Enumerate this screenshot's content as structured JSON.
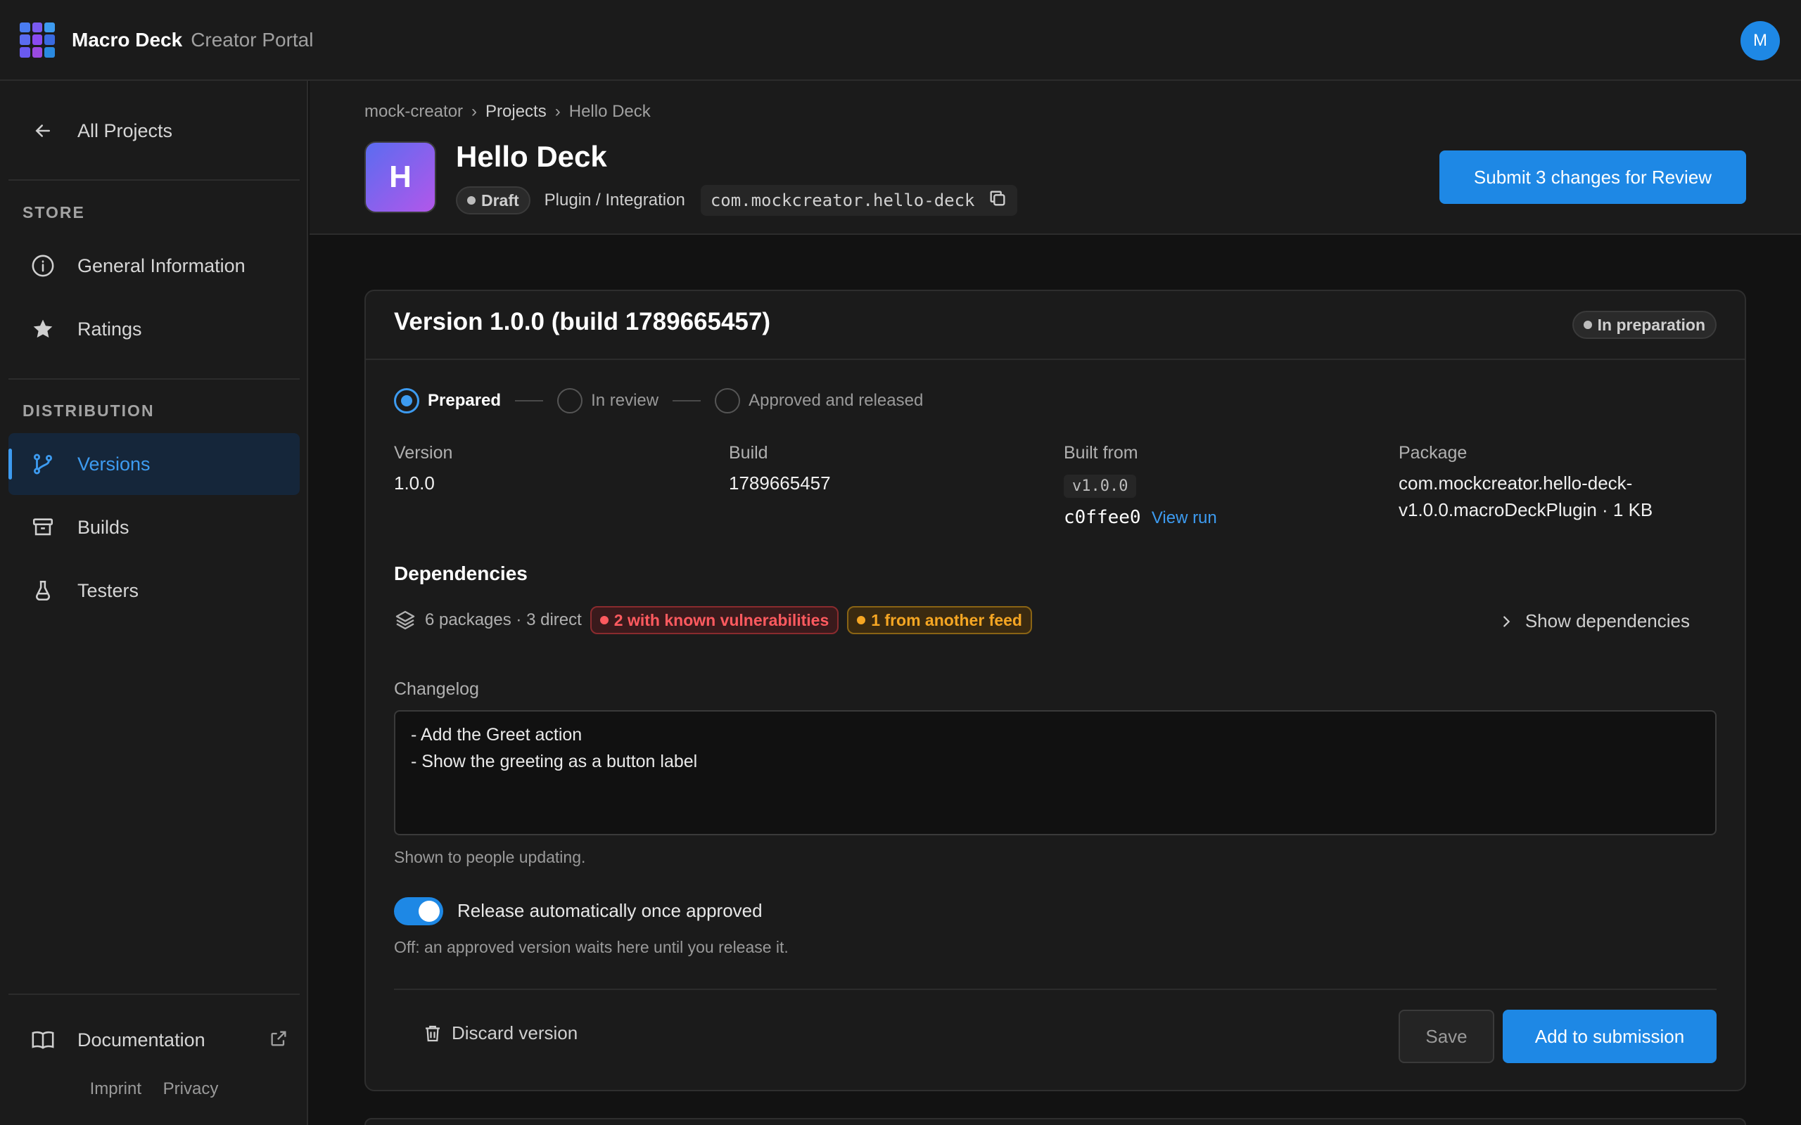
{
  "app": {
    "brand": "Macro Deck",
    "subtitle": "Creator Portal",
    "avatar_initial": "M",
    "logo_colors": [
      "#4a7cf0",
      "#7a5af0",
      "#3d9bf0",
      "#5b6cf0",
      "#8a4af0",
      "#3a6ae0",
      "#6a5af0",
      "#9a4ae0",
      "#2a8ae0"
    ]
  },
  "sidebar": {
    "back_label": "All Projects",
    "store_heading": "STORE",
    "store_items": [
      {
        "label": "General Information",
        "icon": "info-icon"
      },
      {
        "label": "Ratings",
        "icon": "star-icon"
      }
    ],
    "distribution_heading": "DISTRIBUTION",
    "distribution_items": [
      {
        "label": "Versions",
        "icon": "branch-icon",
        "active": true
      },
      {
        "label": "Builds",
        "icon": "archive-icon"
      },
      {
        "label": "Testers",
        "icon": "flask-icon"
      }
    ],
    "documentation_label": "Documentation",
    "imprint": "Imprint",
    "privacy": "Privacy"
  },
  "header": {
    "breadcrumb": [
      "mock-creator",
      "Projects",
      "Hello Deck"
    ],
    "breadcrumb_sep": "›",
    "app_initial": "H",
    "app_name": "Hello Deck",
    "status": "Draft",
    "category": "Plugin / Integration",
    "package_id": "com.mockcreator.hello-deck",
    "submit_label": "Submit 3 changes for Review"
  },
  "version_card": {
    "title": "Version 1.0.0 (build 1789665457)",
    "status": "In preparation",
    "steps": [
      {
        "label": "Prepared",
        "active": true
      },
      {
        "label": "In review",
        "active": false
      },
      {
        "label": "Approved and released",
        "active": false
      }
    ],
    "fields": {
      "version_label": "Version",
      "version_value": "1.0.0",
      "build_label": "Build",
      "build_value": "1789665457",
      "built_from_label": "Built from",
      "built_from_tag": "v1.0.0",
      "built_from_commit": "c0ffee0",
      "view_run": "View run",
      "package_label": "Package",
      "package_line1": "com.mockcreator.hello-deck-",
      "package_line2": "v1.0.0.macroDeckPlugin · 1 KB"
    },
    "dependencies": {
      "title": "Dependencies",
      "summary": "6 packages · 3 direct",
      "vulnerabilities": "2 with known vulnerabilities",
      "other_feed": "1 from another feed",
      "show_label": "Show dependencies"
    },
    "changelog": {
      "label": "Changelog",
      "value": "- Add the Greet action\n- Show the greeting as a button label",
      "hint": "Shown to people updating."
    },
    "auto_release": {
      "label": "Release automatically once approved",
      "enabled": true,
      "hint": "Off: an approved version waits here until you release it."
    },
    "discard_label": "Discard version",
    "save_label": "Save",
    "add_label": "Add to submission"
  },
  "colors": {
    "accent": "#1e88e5",
    "danger": "#ff5a5f",
    "warning": "#f5a623"
  }
}
